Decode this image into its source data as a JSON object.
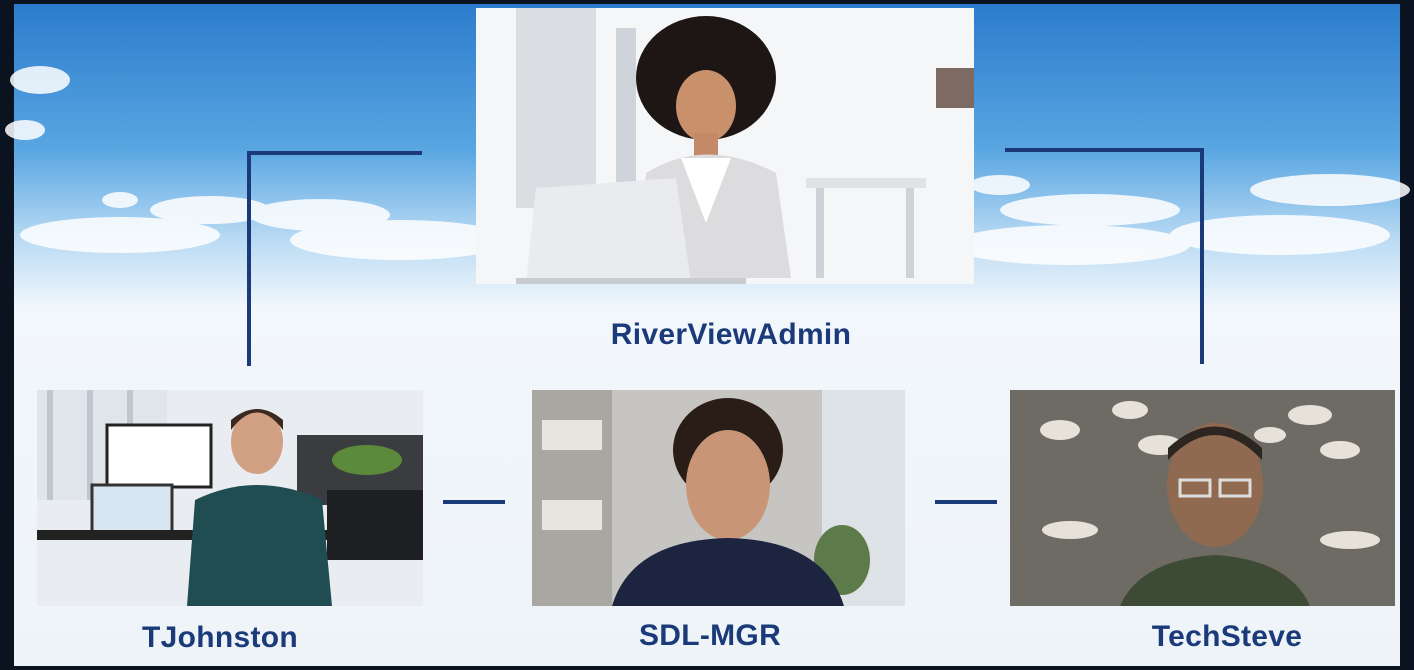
{
  "diagram": {
    "nodes": [
      {
        "id": "admin",
        "name": "RiverViewAdmin",
        "photo": "photo-woman-at-laptop"
      },
      {
        "id": "tj",
        "name": "TJohnston",
        "photo": "photo-man-at-desk"
      },
      {
        "id": "sdl",
        "name": "SDL-MGR",
        "photo": "photo-woman-portrait"
      },
      {
        "id": "tech",
        "name": "TechSteve",
        "photo": "photo-man-glasses"
      }
    ],
    "edges": [
      {
        "from": "admin",
        "to": "tj"
      },
      {
        "from": "admin",
        "to": "tech"
      },
      {
        "from": "tj",
        "to": "sdl"
      },
      {
        "from": "sdl",
        "to": "tech"
      }
    ]
  },
  "colors": {
    "accent": "#1b3a7a",
    "sky_top": "#2a7fd0",
    "sky_bottom": "#eef4fb",
    "frame": "#0b1220"
  }
}
